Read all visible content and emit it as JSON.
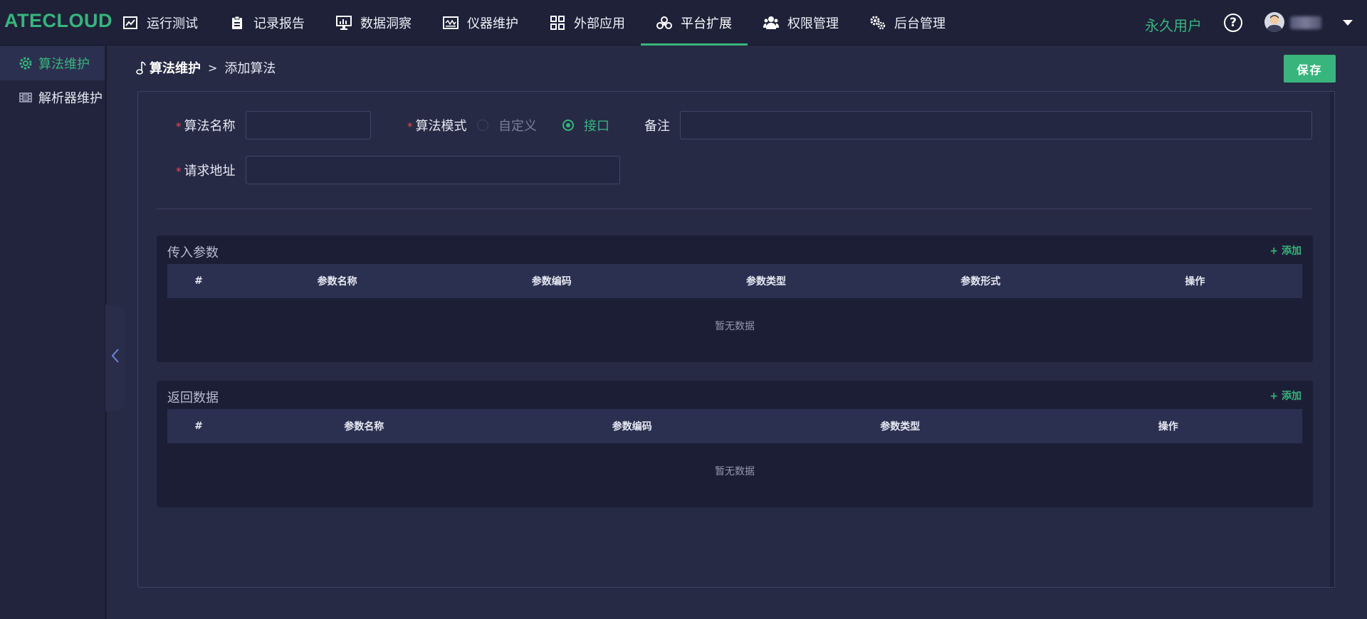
{
  "app": {
    "logo": "ATECLOUD"
  },
  "nav": [
    {
      "label": "运行测试",
      "icon": "chart-line-icon",
      "active": false
    },
    {
      "label": "记录报告",
      "icon": "clipboard-icon",
      "active": false
    },
    {
      "label": "数据洞察",
      "icon": "monitor-chart-icon",
      "active": false
    },
    {
      "label": "仪器维护",
      "icon": "instrument-icon",
      "active": false
    },
    {
      "label": "外部应用",
      "icon": "grid-icon",
      "active": false
    },
    {
      "label": "平台扩展",
      "icon": "extension-icon",
      "active": true
    },
    {
      "label": "权限管理",
      "icon": "users-icon",
      "active": false
    },
    {
      "label": "后台管理",
      "icon": "gears-icon",
      "active": false
    }
  ],
  "header_right": {
    "user_type": "永久用户",
    "help": "?"
  },
  "sidebar": {
    "items": [
      {
        "label": "算法维护",
        "icon": "gear-icon",
        "active": true
      },
      {
        "label": "解析器维护",
        "icon": "film-icon",
        "active": false
      }
    ]
  },
  "breadcrumb": {
    "root": "算法维护",
    "separator": ">",
    "current": "添加算法"
  },
  "toolbar": {
    "save_label": "保存"
  },
  "form": {
    "required_mark": "*",
    "name_label": "算法名称",
    "name_value": "",
    "mode_label": "算法模式",
    "mode_options": [
      {
        "label": "自定义",
        "checked": false
      },
      {
        "label": "接口",
        "checked": true
      }
    ],
    "remark_label": "备注",
    "remark_value": "",
    "url_label": "请求地址",
    "url_value": ""
  },
  "input_params": {
    "title": "传入参数",
    "add_label": "+ 添加",
    "columns": [
      "#",
      "参数名称",
      "参数编码",
      "参数类型",
      "参数形式",
      "操作"
    ],
    "rows": [],
    "empty_text": "暂无数据"
  },
  "return_data": {
    "title": "返回数据",
    "add_label": "+ 添加",
    "columns": [
      "#",
      "参数名称",
      "参数编码",
      "参数类型",
      "操作"
    ],
    "rows": [],
    "empty_text": "暂无数据"
  },
  "colors": {
    "accent": "#37b57c",
    "required": "#e84a4a",
    "background": "#272a45",
    "topbar": "#1e2138"
  }
}
